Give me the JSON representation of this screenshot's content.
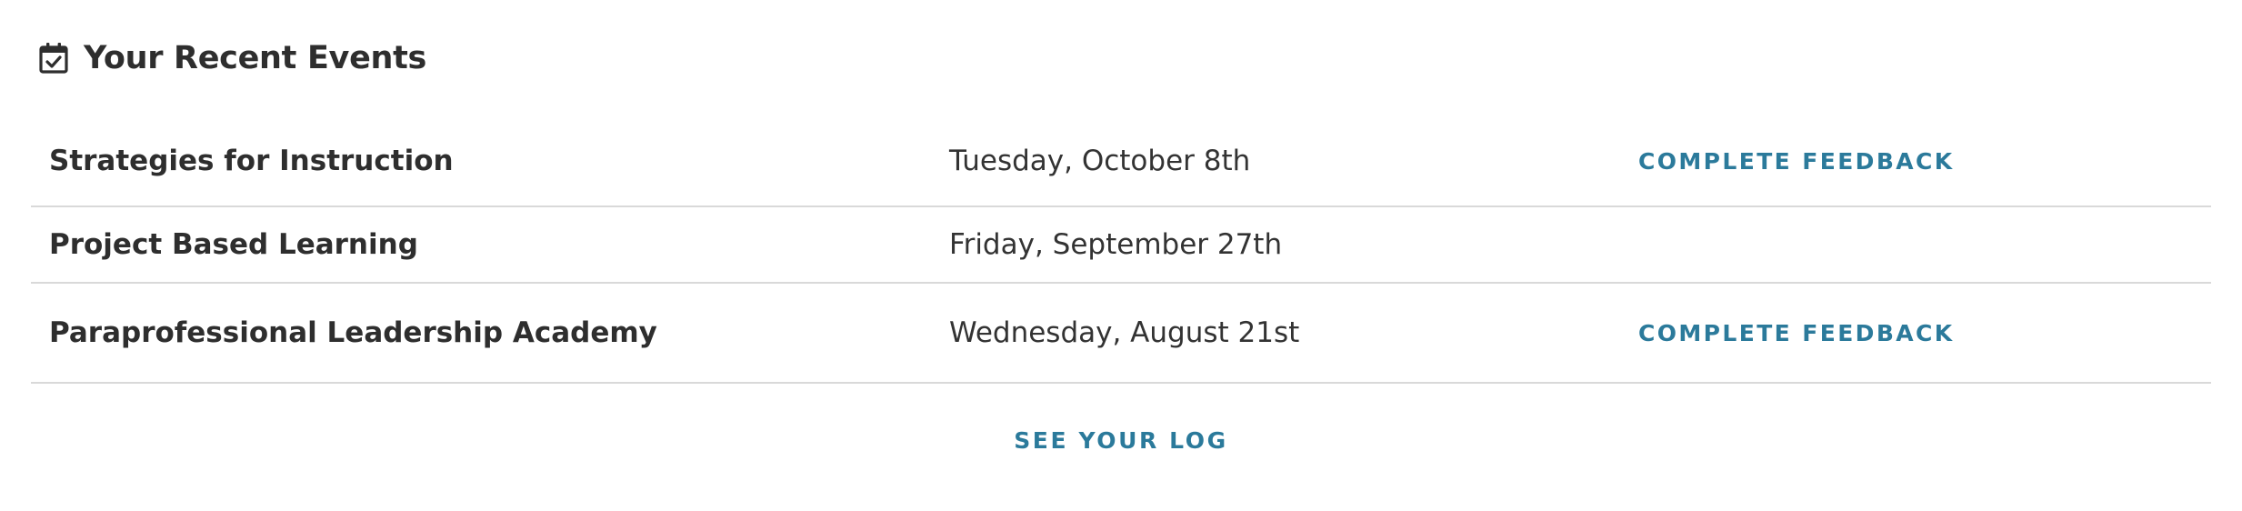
{
  "header": {
    "icon": "calendar-check-icon",
    "title": "Your Recent Events"
  },
  "events": [
    {
      "name": "Strategies for Instruction",
      "date": "Tuesday, October 8th",
      "action": "COMPLETE FEEDBACK"
    },
    {
      "name": "Project Based Learning",
      "date": "Friday, September 27th",
      "action": ""
    },
    {
      "name": "Paraprofessional Leadership Academy",
      "date": "Wednesday, August 21st",
      "action": "COMPLETE FEEDBACK"
    }
  ],
  "footer": {
    "link_label": "SEE YOUR LOG"
  },
  "colors": {
    "text": "#2e2e2e",
    "link": "#2b7a9b",
    "divider": "#d9d9d9"
  }
}
